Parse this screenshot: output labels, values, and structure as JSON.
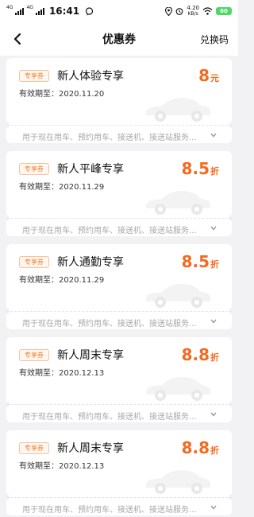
{
  "status_bar": {
    "network": "4G",
    "time": "16:41",
    "speed_value": "4.20",
    "speed_unit": "KB/s",
    "battery": "60"
  },
  "header": {
    "title": "优惠券",
    "redeem_label": "兑换码"
  },
  "coupons": [
    {
      "tag": "专享券",
      "name": "新人体验专享",
      "validity": "有效期至：2020.11.20",
      "discount": "8",
      "unit": "元",
      "scope": "用于现在用车、预约用车、接送机、接送站服务..."
    },
    {
      "tag": "专享券",
      "name": "新人平峰专享",
      "validity": "有效期至：2020.11.29",
      "discount": "8.5",
      "unit": "折",
      "scope": "用于现在用车、预约用车、接送机、接送站服务..."
    },
    {
      "tag": "专享券",
      "name": "新人通勤专享",
      "validity": "有效期至：2020.11.29",
      "discount": "8.5",
      "unit": "折",
      "scope": "用于现在用车、预约用车、接送机、接送站服务..."
    },
    {
      "tag": "专享券",
      "name": "新人周末专享",
      "validity": "有效期至：2020.12.13",
      "discount": "8.8",
      "unit": "折",
      "scope": "用于现在用车、预约用车、接送机、接送站服务..."
    },
    {
      "tag": "专享券",
      "name": "新人周末专享",
      "validity": "有效期至：2020.12.13",
      "discount": "8.8",
      "unit": "折",
      "scope": "用于现在用车、预约用车、接送机、接送站服务..."
    }
  ],
  "colors": {
    "accent": "#f26b21",
    "tag_border": "#f7c39b",
    "background": "#f2f2f4"
  },
  "icons": {
    "back": "chevron-left-icon",
    "expand": "chevron-down-icon",
    "car": "car-watermark-icon"
  }
}
